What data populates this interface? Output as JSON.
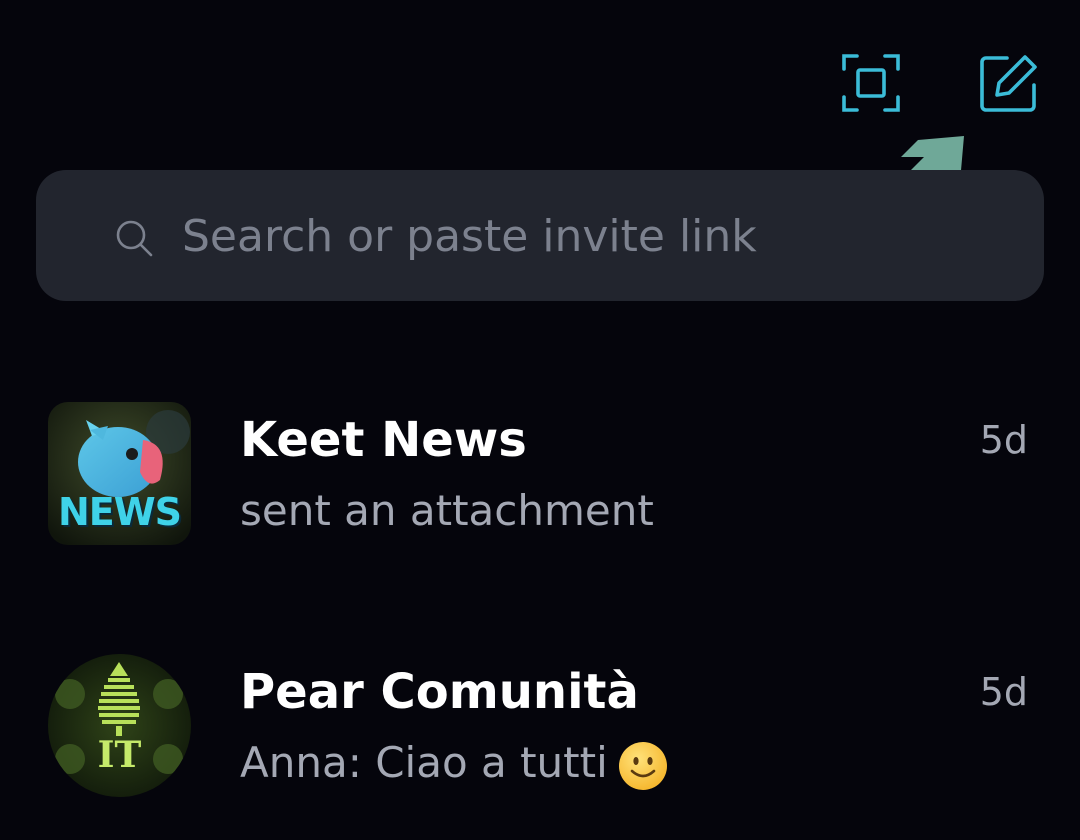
{
  "header": {
    "scan_icon": "scan-qr-icon",
    "compose_icon": "new-chat-icon",
    "accent_color": "#3bbcd8",
    "annotation_color": "#6fa898"
  },
  "search": {
    "placeholder": "Search or paste invite link",
    "value": "",
    "icon": "search-icon"
  },
  "chats": [
    {
      "name": "Keet News",
      "preview": "sent an attachment",
      "time": "5d",
      "avatar_text": "NEWS"
    },
    {
      "name": "Pear Comunità",
      "preview": "Anna: Ciao a tutti",
      "preview_emoji": "slightly-smiling-face-emoji",
      "time": "5d",
      "avatar_text": "IT"
    }
  ]
}
